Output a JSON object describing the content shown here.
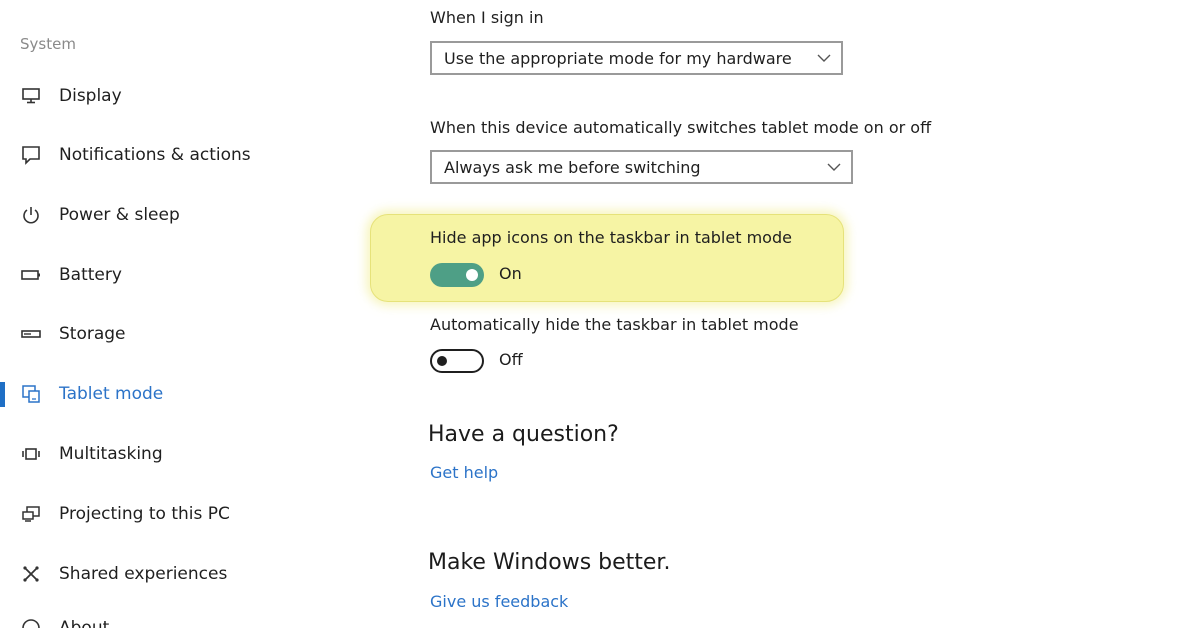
{
  "sidebar": {
    "section_title": "System",
    "items": [
      {
        "label": "Display",
        "icon": "monitor-icon"
      },
      {
        "label": "Notifications & actions",
        "icon": "message-icon"
      },
      {
        "label": "Power & sleep",
        "icon": "power-icon"
      },
      {
        "label": "Battery",
        "icon": "battery-icon"
      },
      {
        "label": "Storage",
        "icon": "storage-icon"
      },
      {
        "label": "Tablet mode",
        "icon": "tablet-mode-icon",
        "active": true
      },
      {
        "label": "Multitasking",
        "icon": "multitasking-icon"
      },
      {
        "label": "Projecting to this PC",
        "icon": "projecting-icon"
      },
      {
        "label": "Shared experiences",
        "icon": "shared-experiences-icon"
      },
      {
        "label": "About",
        "icon": "info-icon"
      }
    ]
  },
  "main": {
    "sign_in": {
      "label": "When I sign in",
      "value": "Use the appropriate mode for my hardware"
    },
    "auto_switch": {
      "label": "When this device automatically switches tablet mode on or off",
      "value": "Always ask me before switching"
    },
    "hide_app_icons": {
      "label": "Hide app icons on the taskbar in tablet mode",
      "state": "On",
      "enabled": true
    },
    "auto_hide_taskbar": {
      "label": "Automatically hide the taskbar in tablet mode",
      "state": "Off",
      "enabled": false
    },
    "question": {
      "heading": "Have a question?",
      "link": "Get help"
    },
    "feedback": {
      "heading": "Make Windows better.",
      "link": "Give us feedback"
    }
  },
  "colors": {
    "accent": "#2b73c8",
    "toggle_on": "#4e9f86",
    "highlight": "#f6f4a4"
  }
}
